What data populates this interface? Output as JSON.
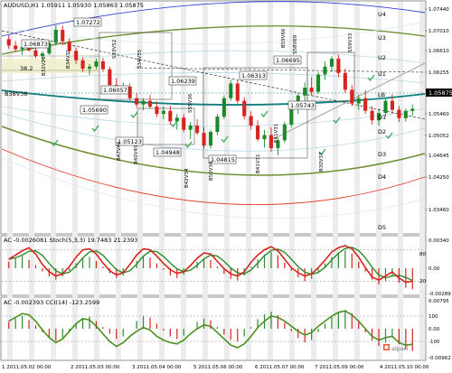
{
  "chart_data": {
    "type": "candlestick",
    "main": {
      "symbol_line": "AUDUSD,H1  1.05911 1.05930 1.05863 1.05875",
      "current_price": "1.05875",
      "price_min": 1.0339,
      "price_max": 1.0756,
      "price_ticks": [
        "1.07440",
        "1.07010",
        "1.06610",
        "1.06255",
        "1.05875",
        "1.05460",
        "1.05052",
        "1.04645",
        "1.04250",
        "1.03460"
      ],
      "resistance_labels": [
        "U4",
        "U3",
        "U2",
        "U1",
        "LB",
        "D1",
        "D2",
        "D3",
        "D4",
        "D5"
      ],
      "level_boxes": [
        "1.07272",
        "1.06873",
        "1.06239",
        "1.06313",
        "1.06695",
        "1.06057",
        "1.05690",
        "1.05743",
        "1.05123",
        "1.04948",
        "1.04815"
      ],
      "fib_labels": [
        "38.2",
        "B38V38"
      ],
      "rotated_labels": [
        "B32V26",
        "B34V31",
        "S33V52",
        "S34V55",
        "S55V36",
        "B47V46",
        "B40V45",
        "B42V34",
        "B50V34",
        "B41V31",
        "E41V31",
        "B59V66",
        "S58V69",
        "B30V37",
        "S59V33"
      ],
      "candles": [
        [
          1.0702,
          1.071,
          1.0684,
          1.069
        ],
        [
          1.069,
          1.0699,
          1.0678,
          1.0683
        ],
        [
          1.0683,
          1.0691,
          1.0672,
          1.0687
        ],
        [
          1.0687,
          1.0695,
          1.0679,
          1.0681
        ],
        [
          1.0681,
          1.0688,
          1.0666,
          1.067
        ],
        [
          1.067,
          1.0679,
          1.066,
          1.0675
        ],
        [
          1.0675,
          1.07,
          1.0672,
          1.0695
        ],
        [
          1.0695,
          1.0729,
          1.069,
          1.072
        ],
        [
          1.072,
          1.0728,
          1.069,
          1.0698
        ],
        [
          1.0698,
          1.0704,
          1.0674,
          1.068
        ],
        [
          1.068,
          1.0686,
          1.0655,
          1.0662
        ],
        [
          1.0662,
          1.0668,
          1.064,
          1.0646
        ],
        [
          1.0646,
          1.0655,
          1.0634,
          1.065
        ],
        [
          1.065,
          1.0665,
          1.0645,
          1.066
        ],
        [
          1.066,
          1.0667,
          1.064,
          1.0645
        ],
        [
          1.0645,
          1.065,
          1.061,
          1.0615
        ],
        [
          1.0615,
          1.0628,
          1.06,
          1.0604
        ],
        [
          1.0604,
          1.062,
          1.0598,
          1.0612
        ],
        [
          1.0612,
          1.0618,
          1.0585,
          1.059
        ],
        [
          1.059,
          1.06,
          1.0572,
          1.0578
        ],
        [
          1.0578,
          1.059,
          1.0567,
          1.0585
        ],
        [
          1.0585,
          1.0596,
          1.057,
          1.0574
        ],
        [
          1.0574,
          1.0584,
          1.0554,
          1.056
        ],
        [
          1.056,
          1.0575,
          1.055,
          1.0566
        ],
        [
          1.0566,
          1.0576,
          1.054,
          1.0546
        ],
        [
          1.0546,
          1.056,
          1.053,
          1.0553
        ],
        [
          1.0553,
          1.056,
          1.0525,
          1.053
        ],
        [
          1.053,
          1.0545,
          1.0512,
          1.0538
        ],
        [
          1.0538,
          1.055,
          1.052,
          1.0524
        ],
        [
          1.0524,
          1.0535,
          1.0495,
          1.05
        ],
        [
          1.05,
          1.053,
          1.0494,
          1.0526
        ],
        [
          1.0526,
          1.056,
          1.052,
          1.0555
        ],
        [
          1.0555,
          1.0595,
          1.055,
          1.059
        ],
        [
          1.059,
          1.0625,
          1.0585,
          1.0618
        ],
        [
          1.0618,
          1.0624,
          1.058,
          1.0585
        ],
        [
          1.0585,
          1.0592,
          1.055,
          1.0556
        ],
        [
          1.0556,
          1.0565,
          1.053,
          1.0538
        ],
        [
          1.0538,
          1.0548,
          1.0508,
          1.0512
        ],
        [
          1.0512,
          1.053,
          1.0496,
          1.052
        ],
        [
          1.052,
          1.0535,
          1.0488,
          1.0495
        ],
        [
          1.0495,
          1.0515,
          1.0482,
          1.051
        ],
        [
          1.051,
          1.0545,
          1.0505,
          1.054
        ],
        [
          1.054,
          1.0575,
          1.0535,
          1.057
        ],
        [
          1.057,
          1.06,
          1.056,
          1.0595
        ],
        [
          1.0595,
          1.062,
          1.058,
          1.061
        ],
        [
          1.061,
          1.063,
          1.0595,
          1.0602
        ],
        [
          1.0602,
          1.064,
          1.0598,
          1.0635
        ],
        [
          1.0635,
          1.066,
          1.0625,
          1.065
        ],
        [
          1.065,
          1.067,
          1.064,
          1.0665
        ],
        [
          1.0665,
          1.0672,
          1.063,
          1.0638
        ],
        [
          1.0638,
          1.0646,
          1.06,
          1.0606
        ],
        [
          1.0606,
          1.0615,
          1.0575,
          1.058
        ],
        [
          1.058,
          1.0597,
          1.0568,
          1.059
        ],
        [
          1.059,
          1.0605,
          1.056,
          1.0566
        ],
        [
          1.0566,
          1.0575,
          1.054,
          1.0548
        ],
        [
          1.0548,
          1.057,
          1.0538,
          1.0562
        ],
        [
          1.0562,
          1.059,
          1.0555,
          1.0585
        ],
        [
          1.0585,
          1.0598,
          1.056,
          1.0568
        ],
        [
          1.0568,
          1.0575,
          1.0545,
          1.0552
        ],
        [
          1.0552,
          1.057,
          1.0546,
          1.0566
        ],
        [
          1.0566,
          1.0578,
          1.0556,
          1.057
        ]
      ],
      "date_labels": [
        "1 2011.05.02 00:00",
        "2 2011.05.03 00:00",
        "3 2011.05.04 00:00",
        "5 2011.05.06 00:00",
        "6 2011.05.07 00:00",
        "7 2011.05.09 00:00",
        "4 2011.05.10 00:00",
        "2011.05.11 00:00"
      ]
    },
    "panel2": {
      "label": "AC  -0.0026081  Stoch(5,3,3) 19.7483 21.2393",
      "ticks": [
        "0.00340",
        "0.00",
        "-0.00289"
      ],
      "levels": [
        "80",
        "20"
      ],
      "k_line": [
        62,
        70,
        78,
        84,
        72,
        52,
        38,
        30,
        34,
        48,
        66,
        80,
        82,
        72,
        55,
        40,
        32,
        36,
        52,
        70,
        82,
        80,
        68,
        54,
        42,
        35,
        38,
        50,
        64,
        74,
        72,
        58,
        44,
        34,
        30,
        38,
        56,
        70,
        80,
        86,
        78,
        62,
        46,
        36,
        30,
        34,
        46,
        60,
        76,
        84,
        88,
        82,
        66,
        46,
        28,
        22,
        30,
        38,
        26,
        18,
        20
      ],
      "ac_hist": [
        0.0008,
        0.0012,
        0.0015,
        0.001,
        0.0004,
        -0.0004,
        -0.001,
        -0.0014,
        -0.001,
        -0.0003,
        0.0006,
        0.0012,
        0.0014,
        0.0009,
        0.0002,
        -0.0006,
        -0.0012,
        -0.0009,
        0.0,
        0.0009,
        0.0015,
        0.0013,
        0.0006,
        -0.0002,
        -0.0009,
        -0.0012,
        -0.0008,
        0.0,
        0.0008,
        0.0012,
        0.001,
        0.0002,
        -0.0007,
        -0.0013,
        -0.0015,
        -0.0009,
        0.0002,
        0.0011,
        0.0017,
        0.002,
        0.0016,
        0.0007,
        -0.0003,
        -0.0011,
        -0.0016,
        -0.0013,
        -0.0004,
        0.0006,
        0.0014,
        0.0019,
        0.0022,
        0.0018,
        0.0008,
        -0.0004,
        -0.0014,
        -0.002,
        -0.0016,
        -0.001,
        -0.0018,
        -0.0024,
        -0.0026
      ]
    },
    "panel3": {
      "label": "AC  -0.002393  CCI(14) -123.2599",
      "ticks": [
        "0.00795",
        "100",
        "0.00",
        "-100",
        "-0.00962"
      ],
      "cci_line": [
        60,
        90,
        120,
        110,
        60,
        -10,
        -70,
        -110,
        -80,
        -20,
        40,
        80,
        70,
        20,
        -40,
        -100,
        -140,
        -110,
        -60,
        -20,
        10,
        -10,
        -60,
        -90,
        -110,
        -120,
        -90,
        -40,
        0,
        30,
        20,
        -30,
        -80,
        -130,
        -150,
        -120,
        -60,
        10,
        60,
        100,
        90,
        60,
        20,
        -20,
        -50,
        -30,
        20,
        60,
        100,
        130,
        140,
        110,
        60,
        0,
        -60,
        -90,
        -70,
        -60,
        -110,
        -130,
        -123
      ]
    },
    "watermark": "alpari"
  }
}
